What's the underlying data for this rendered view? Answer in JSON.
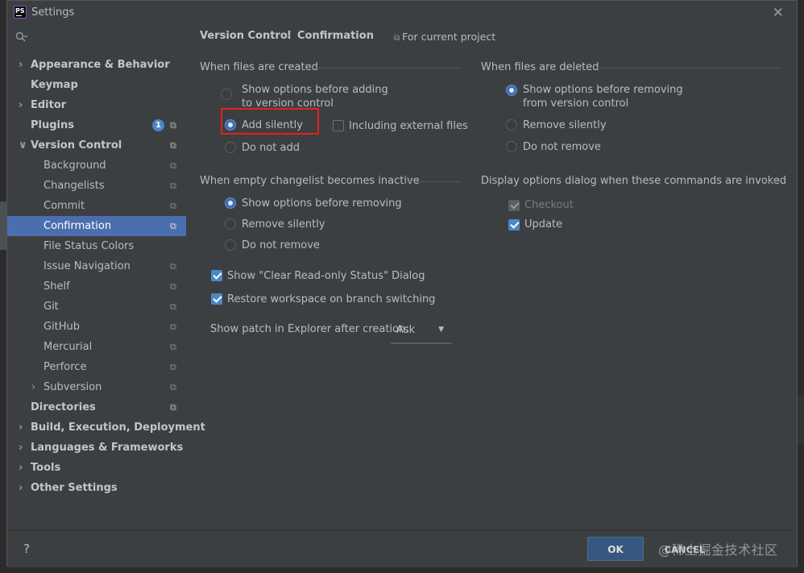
{
  "window": {
    "title": "Settings",
    "app_icon_text": "PS"
  },
  "sidebar": {
    "items": [
      {
        "label": "Appearance & Behavior",
        "bold": true,
        "arrow": "right",
        "level": 0
      },
      {
        "label": "Keymap",
        "bold": true,
        "level": 0
      },
      {
        "label": "Editor",
        "bold": true,
        "arrow": "right",
        "level": 0
      },
      {
        "label": "Plugins",
        "bold": true,
        "level": 0,
        "badge": "1",
        "project": true
      },
      {
        "label": "Version Control",
        "bold": true,
        "arrow": "down",
        "level": 0,
        "project": true
      },
      {
        "label": "Background",
        "level": 1,
        "project": true
      },
      {
        "label": "Changelists",
        "level": 1,
        "project": true
      },
      {
        "label": "Commit",
        "level": 1,
        "project": true
      },
      {
        "label": "Confirmation",
        "level": 1,
        "project": true,
        "selected": true
      },
      {
        "label": "File Status Colors",
        "level": 1
      },
      {
        "label": "Issue Navigation",
        "level": 1,
        "project": true
      },
      {
        "label": "Shelf",
        "level": 1,
        "project": true
      },
      {
        "label": "Git",
        "level": 1,
        "project": true
      },
      {
        "label": "GitHub",
        "level": 1,
        "project": true
      },
      {
        "label": "Mercurial",
        "level": 1,
        "project": true
      },
      {
        "label": "Perforce",
        "level": 1,
        "project": true
      },
      {
        "label": "Subversion",
        "level": 1,
        "arrow": "right",
        "project": true
      },
      {
        "label": "Directories",
        "bold": true,
        "level": 0,
        "project": true
      },
      {
        "label": "Build, Execution, Deployment",
        "bold": true,
        "arrow": "right",
        "level": 0
      },
      {
        "label": "Languages & Frameworks",
        "bold": true,
        "arrow": "right",
        "level": 0
      },
      {
        "label": "Tools",
        "bold": true,
        "arrow": "right",
        "level": 0
      },
      {
        "label": "Other Settings",
        "bold": true,
        "arrow": "right",
        "level": 0
      }
    ]
  },
  "header": {
    "breadcrumb_parent": "Version Control",
    "breadcrumb_sep": "›",
    "breadcrumb_current": "Confirmation",
    "scope": "For current project"
  },
  "created": {
    "title": "When files are created",
    "opt_show_line1": "Show options before adding",
    "opt_show_line2": "to version control",
    "opt_add": "Add silently",
    "opt_none": "Do not add",
    "including_external": "Including external files"
  },
  "deleted": {
    "title": "When files are deleted",
    "opt_show_line1": "Show options before removing",
    "opt_show_line2": "from version control",
    "opt_remove": "Remove silently",
    "opt_none": "Do not remove"
  },
  "empty_changelist": {
    "title": "When empty changelist becomes inactive",
    "opt_show": "Show options before removing",
    "opt_remove": "Remove silently",
    "opt_none": "Do not remove"
  },
  "commands": {
    "title": "Display options dialog when these commands are invoked",
    "checkout": "Checkout",
    "update": "Update"
  },
  "checks": {
    "clear_readonly": "Show \"Clear Read-only Status\" Dialog",
    "restore_workspace": "Restore workspace on branch switching"
  },
  "patch": {
    "label": "Show patch in Explorer after creation:",
    "value": "Ask"
  },
  "buttons": {
    "help": "?",
    "ok": "OK",
    "cancel": "CANCEL"
  },
  "watermark": "@稀土掘金技术社区",
  "colors": {
    "accent": "#4a88c7",
    "selected": "#4b6eaf",
    "highlight": "#e0231c",
    "background": "#3c3f41"
  }
}
